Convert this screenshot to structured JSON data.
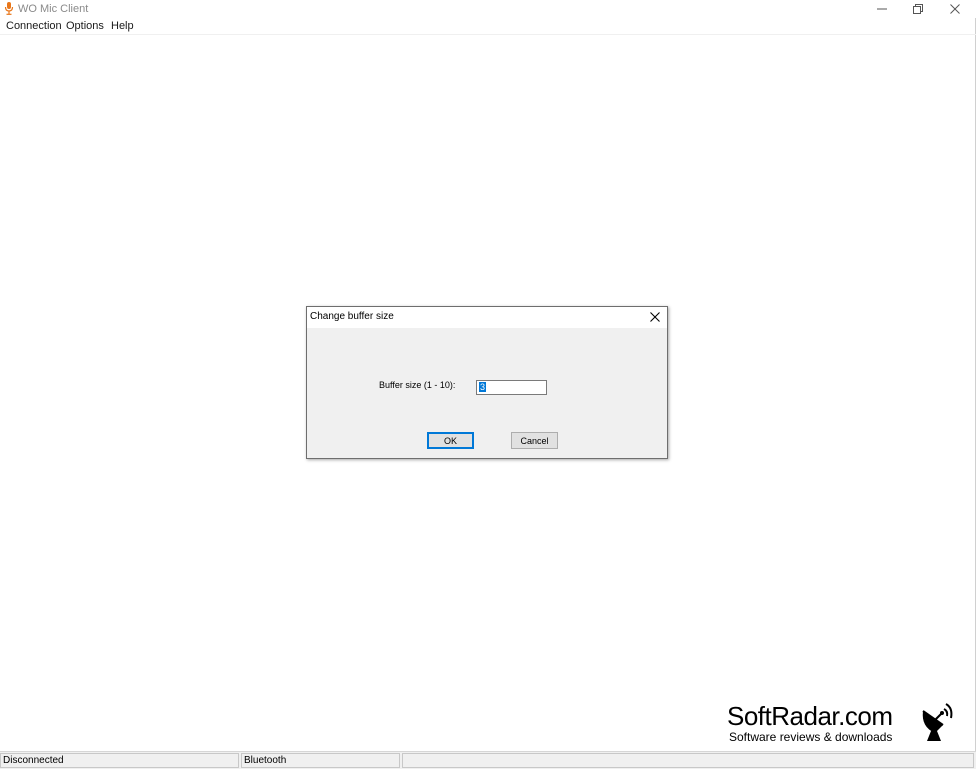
{
  "window": {
    "title": "WO Mic Client",
    "icon": "microphone-icon",
    "controls": [
      "minimize-icon",
      "restore-icon",
      "close-icon"
    ]
  },
  "menu": {
    "connection": "Connection",
    "options": "Options",
    "help": "Help"
  },
  "dialog": {
    "title": "Change buffer size",
    "label": "Buffer size (1 - 10):",
    "value": "3",
    "ok_label": "OK",
    "cancel_label": "Cancel"
  },
  "watermark": {
    "title": "SoftRadar.com",
    "subtitle": "Software reviews & downloads",
    "icon": "satellite-dish-icon"
  },
  "status": {
    "connection": "Disconnected",
    "mode": "Bluetooth",
    "extra": ""
  },
  "colors": {
    "selection": "#0078d7",
    "dialog_bg": "#f0f0f0",
    "icon_accent": "#e8761a"
  }
}
